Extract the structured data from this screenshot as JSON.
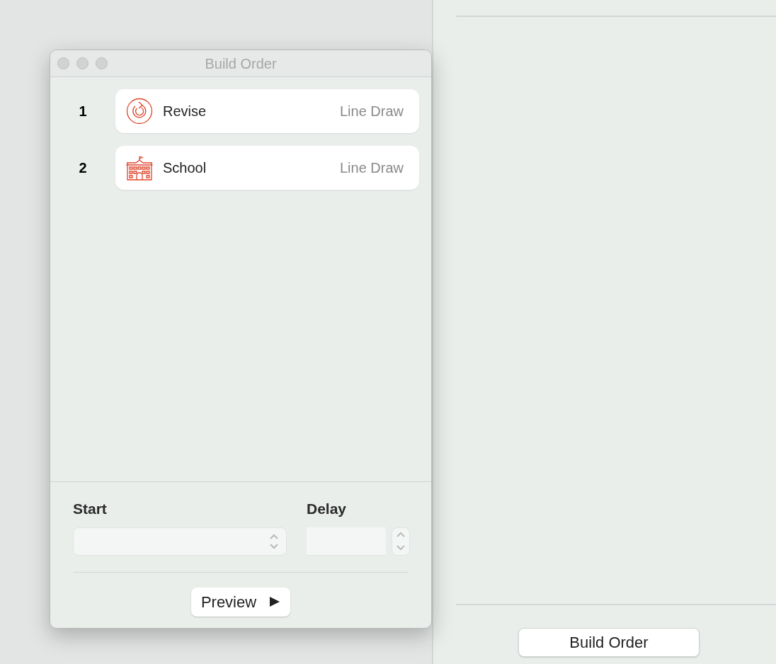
{
  "window": {
    "title": "Build Order"
  },
  "steps": [
    {
      "number": "1",
      "name": "Revise",
      "effect": "Line Draw",
      "kind": "revise"
    },
    {
      "number": "2",
      "name": "School",
      "effect": "Line Draw",
      "kind": "school"
    }
  ],
  "start": {
    "label": "Start"
  },
  "delay": {
    "label": "Delay"
  },
  "preview_button": {
    "label": "Preview"
  },
  "side_panel": {
    "button": "Build Order"
  }
}
